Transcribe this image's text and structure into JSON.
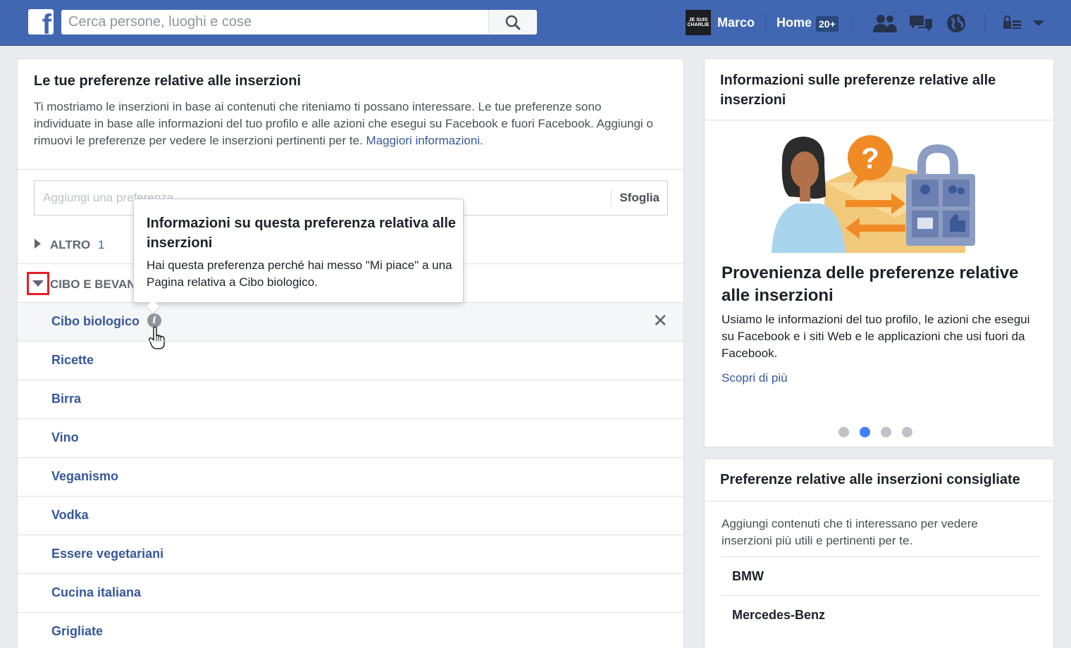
{
  "header": {
    "logo": "f",
    "search_placeholder": "Cerca persone, luoghi e cose",
    "avatar_text": "JE SUIS CHARLIE",
    "user_name": "Marco",
    "home_label": "Home",
    "home_badge": "20+"
  },
  "main": {
    "title": "Le tue preferenze relative alle inserzioni",
    "description": "Ti mostriamo le inserzioni in base ai contenuti che riteniamo ti possano interessare. Le tue preferenze sono individuate in base alle informazioni del tuo profilo e alle azioni che esegui su Facebook e fuori Facebook. Aggiungi o rimuovi le preferenze per vedere le inserzioni pertinenti per te.",
    "more_link": "Maggiori informazioni",
    "add_placeholder": "Aggiungi una preferenza",
    "browse_label": "Sfoglia",
    "categories": [
      {
        "label": "ALTRO",
        "count": "1"
      },
      {
        "label": "CIBO E BEVANDE"
      }
    ],
    "items": [
      "Cibo biologico",
      "Ricette",
      "Birra",
      "Vino",
      "Veganismo",
      "Vodka",
      "Essere vegetariani",
      "Cucina italiana",
      "Grigliate"
    ],
    "remove_symbol": "✕"
  },
  "tooltip": {
    "title": "Informazioni su questa preferenza relativa alle inserzioni",
    "body": "Hai questa preferenza perché hai messo \"Mi piace\" a una Pagina relativa a Cibo biologico."
  },
  "info_panel": {
    "title": "Informazioni sulle preferenze relative alle inserzioni",
    "heading": "Provenienza delle preferenze relative alle inserzioni",
    "body": "Usiamo le informazioni del tuo profilo, le azioni che esegui su Facebook e i siti Web e le applicazioni che usi fuori da Facebook.",
    "link": "Scopri di più",
    "carousel_dots": 4,
    "carousel_active_index": 1,
    "accent_color": "#4080ff"
  },
  "suggested_panel": {
    "title": "Preferenze relative alle inserzioni consigliate",
    "body": "Aggiungi contenuti che ti interessano per vedere inserzioni più utili e pertinenti per te.",
    "items": [
      "BMW",
      "Mercedes-Benz"
    ]
  },
  "icons": {
    "search": "search-icon",
    "friends": "friend-requests-icon",
    "messages": "messages-icon",
    "notifications": "globe-notifications-icon",
    "privacy": "privacy-shortcuts-icon",
    "menu": "chevron-down-icon",
    "info": "info-icon",
    "remove": "close-icon"
  },
  "colors": {
    "brand": "#4267b2",
    "link": "#365899",
    "highlight_box": "#e41e26"
  }
}
